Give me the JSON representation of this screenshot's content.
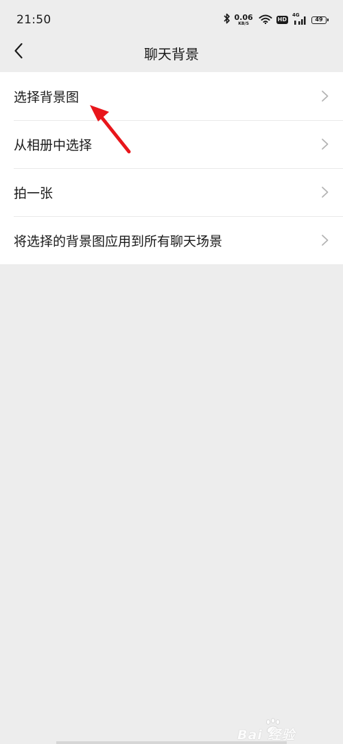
{
  "status_bar": {
    "time": "21:50",
    "net_speed_value": "0.06",
    "net_speed_unit": "KB/S",
    "hd_label": "HD",
    "signal_label": "4G",
    "battery_level": "49",
    "icons": [
      "bluetooth-icon",
      "wifi-icon",
      "signal-icon",
      "battery-icon"
    ]
  },
  "nav": {
    "title": "聊天背景",
    "back_icon": "chevron-left-icon"
  },
  "menu": {
    "items": [
      {
        "label": "选择背景图"
      },
      {
        "label": "从相册中选择"
      },
      {
        "label": "拍一张"
      },
      {
        "label": "将选择的背景图应用到所有聊天场景"
      }
    ],
    "chevron_icon": "chevron-right-icon"
  },
  "annotation": {
    "type": "arrow",
    "color": "#e8161b"
  },
  "watermark": {
    "text": "Bai 经验"
  },
  "colors": {
    "background": "#ededed",
    "list_background": "#ffffff",
    "divider": "#e9e9e9",
    "text": "#1a1a1a",
    "chevron": "#b3b3b3"
  }
}
